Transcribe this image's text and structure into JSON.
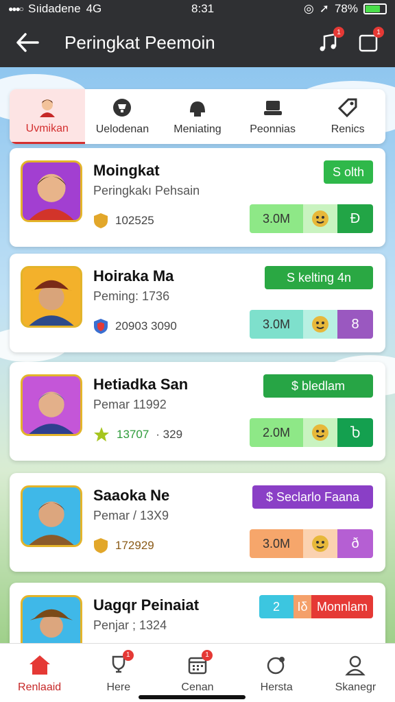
{
  "status_bar": {
    "carrier": "Sıidadene",
    "network": "4G",
    "time": "8:31",
    "battery": "78%"
  },
  "header": {
    "title": "Peringkat Peemoin",
    "music_badge": "1",
    "alert_badge": "1"
  },
  "tabs": [
    {
      "label": "Uvmikan",
      "icon": "avatar-icon",
      "active": true
    },
    {
      "label": "Uelodenan",
      "icon": "trophy-icon"
    },
    {
      "label": "Meniating",
      "icon": "helmet-icon"
    },
    {
      "label": "Peonnias",
      "icon": "group-icon"
    },
    {
      "label": "Renics",
      "icon": "tag-icon"
    }
  ],
  "players": [
    {
      "name": "Moingkat",
      "subtitle": "Peringkakı Pehsain",
      "score": "102525",
      "badge": "S olth",
      "badge_color": "#2fb84a",
      "stat": "3.0M",
      "stat_color": "#8ee887",
      "end_symbol": "Ð",
      "end_color": "#22a546",
      "score_icon": "shield-icon"
    },
    {
      "name": "Hoiraka Ma",
      "subtitle": "Peming: 1736",
      "score": "20903 3090",
      "badge": "S kelting 4n",
      "badge_color": "#2aa843",
      "stat": "3.0M",
      "stat_color": "#7ee0cc",
      "end_symbol": "8",
      "end_color": "#9a58c0",
      "score_icon": "shield-blue-icon"
    },
    {
      "name": "Hetiadka San",
      "subtitle": "Pemar 11992",
      "score": "13707",
      "score_extra": "· 329",
      "badge": "$ bledlam",
      "badge_color": "#27a545",
      "stat": "2.0M",
      "stat_color": "#8ee887",
      "end_symbol": "Ⴆ",
      "end_color": "#14a04f",
      "score_icon": "star-icon"
    },
    {
      "name": "Saaoka Ne",
      "subtitle": "Pemar / 13X9",
      "score": "172929",
      "badge": "$ Seclarlo Faana",
      "badge_color": "#8a3fc6",
      "stat": "3.0M",
      "stat_color": "#f6a66b",
      "end_symbol": "ð",
      "end_color": "#b55fd3",
      "score_icon": "shield-gold-icon"
    },
    {
      "name": "Uagqr Peinaiat",
      "subtitle": "Penjar ; 1324",
      "badge_num_a": "2",
      "badge_num_b": "Iδ",
      "badge": "Monnlam"
    }
  ],
  "nav": [
    {
      "label": "Renlaaid",
      "icon": "home-icon",
      "active": true
    },
    {
      "label": "Here",
      "icon": "trophy-badge-icon",
      "badge": "1"
    },
    {
      "label": "Cenan",
      "icon": "calendar-icon",
      "badge": "1"
    },
    {
      "label": "Hersta",
      "icon": "globe-pin-icon"
    },
    {
      "label": "Skanegr",
      "icon": "user-icon"
    }
  ]
}
